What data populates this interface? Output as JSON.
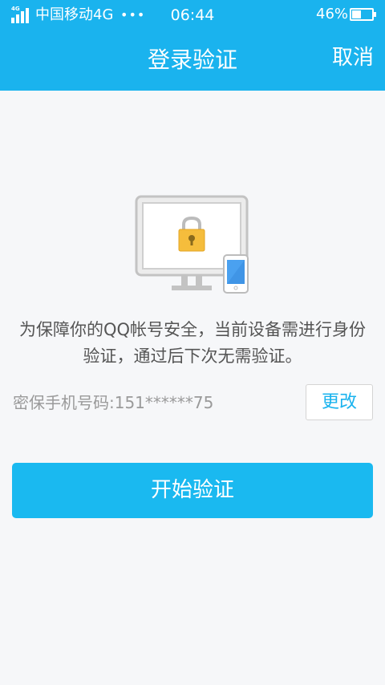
{
  "status_bar": {
    "network_badge": "4G",
    "carrier": "中国移动4G",
    "dots": "•••",
    "time": "06:44",
    "battery_percent": "46%",
    "battery_level": 0.46
  },
  "header": {
    "title": "登录验证",
    "cancel_label": "取消",
    "background_color": "#1ab3ee"
  },
  "illustration": {
    "icon": "monitor-lock-phone-icon",
    "lock_color": "#f5bd3c"
  },
  "description": "为保障你的QQ帐号安全，当前设备需进行身份验证，通过后下次无需验证。",
  "phone": {
    "label": "密保手机号码:151******75",
    "change_label": "更改"
  },
  "start_button": {
    "label": "开始验证",
    "color": "#1ab9f0"
  }
}
